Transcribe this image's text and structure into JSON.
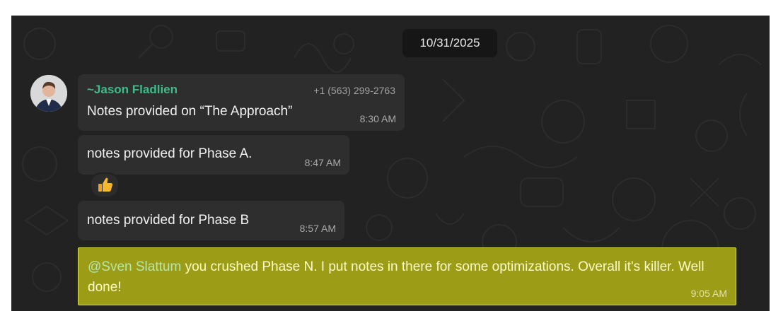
{
  "date_divider": "10/31/2025",
  "messages": [
    {
      "sender": "~Jason Fladlien",
      "phone": "+1 (563) 299-2763",
      "text": "Notes provided on “The Approach”",
      "time": "8:30 AM"
    },
    {
      "text": "notes provided for Phase A.",
      "time": "8:47 AM",
      "reaction": "thumbs-up"
    },
    {
      "text": "notes provided for Phase B",
      "time": "8:57 AM"
    },
    {
      "mention": "@Sven Slattum",
      "text": " you crushed Phase N. I put notes in there for some optimizations. Overall it's killer. Well done!",
      "time": "9:05 AM",
      "highlighted": true
    }
  ],
  "colors": {
    "panel_background": "#222222",
    "bubble_background": "#2e2e2e",
    "sender_name": "#3fbb8b",
    "highlight_background": "#9c9c16",
    "mention": "#b6e6a8"
  }
}
